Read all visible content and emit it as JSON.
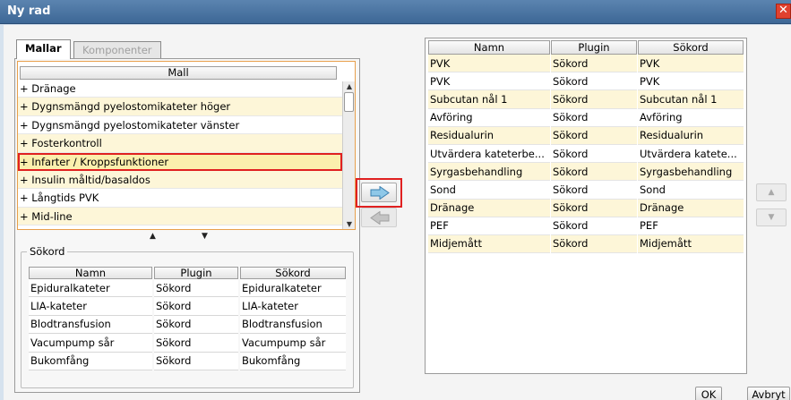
{
  "window": {
    "title": "Ny rad",
    "close_glyph": "✕"
  },
  "tabs": [
    {
      "label": "Mallar",
      "active": true
    },
    {
      "label": "Komponenter",
      "active": false
    }
  ],
  "mall": {
    "header": "Mall",
    "items": [
      "+ Dränage",
      "+ Dygnsmängd pyelostomikateter höger",
      "+ Dygnsmängd pyelostomikateter vänster",
      "+ Fosterkontroll",
      "+ Infarter / Kroppsfunktioner",
      "+ Insulin måltid/basaldos",
      "+ Långtids PVK",
      "+ Mid-line"
    ],
    "selected_index": 4
  },
  "sokord": {
    "legend": "Sökord",
    "columns": [
      "Namn",
      "Plugin",
      "Sökord"
    ],
    "rows": [
      [
        "Epiduralkateter",
        "Sökord",
        "Epiduralkateter"
      ],
      [
        "LIA-kateter",
        "Sökord",
        "LIA-kateter"
      ],
      [
        "Blodtransfusion",
        "Sökord",
        "Blodtransfusion"
      ],
      [
        "Vacumpump sår",
        "Sökord",
        "Vacumpump sår"
      ],
      [
        "Bukomfång",
        "Sökord",
        "Bukomfång"
      ]
    ]
  },
  "right_table": {
    "columns": [
      "Namn",
      "Plugin",
      "Sökord"
    ],
    "rows": [
      [
        "PVK",
        "Sökord",
        "PVK"
      ],
      [
        "PVK",
        "Sökord",
        "PVK"
      ],
      [
        "Subcutan nål 1",
        "Sökord",
        "Subcutan nål 1"
      ],
      [
        "Avföring",
        "Sökord",
        "Avföring"
      ],
      [
        "Residualurin",
        "Sökord",
        "Residualurin"
      ],
      [
        "Utvärdera kateterbe...",
        "Sökord",
        "Utvärdera katete..."
      ],
      [
        "Syrgasbehandling",
        "Sökord",
        "Syrgasbehandling"
      ],
      [
        "Sond",
        "Sökord",
        "Sond"
      ],
      [
        "Dränage",
        "Sökord",
        "Dränage"
      ],
      [
        "PEF",
        "Sökord",
        "PEF"
      ],
      [
        "Midjemått",
        "Sökord",
        "Midjemått"
      ]
    ]
  },
  "buttons": {
    "ok": "OK",
    "cancel": "Avbryt"
  },
  "icons": {
    "move_right": "arrow-right-icon",
    "move_left": "arrow-left-icon",
    "move_up": "▲",
    "move_down": "▼",
    "sort_up": "▲",
    "sort_down": "▼",
    "scroll_up": "▲",
    "scroll_down": "▼"
  },
  "colors": {
    "title_bar": "#3d6796",
    "highlight": "#e02020",
    "row_alt": "#fdf6d8",
    "arrow_fill": "#8fc8e8"
  }
}
